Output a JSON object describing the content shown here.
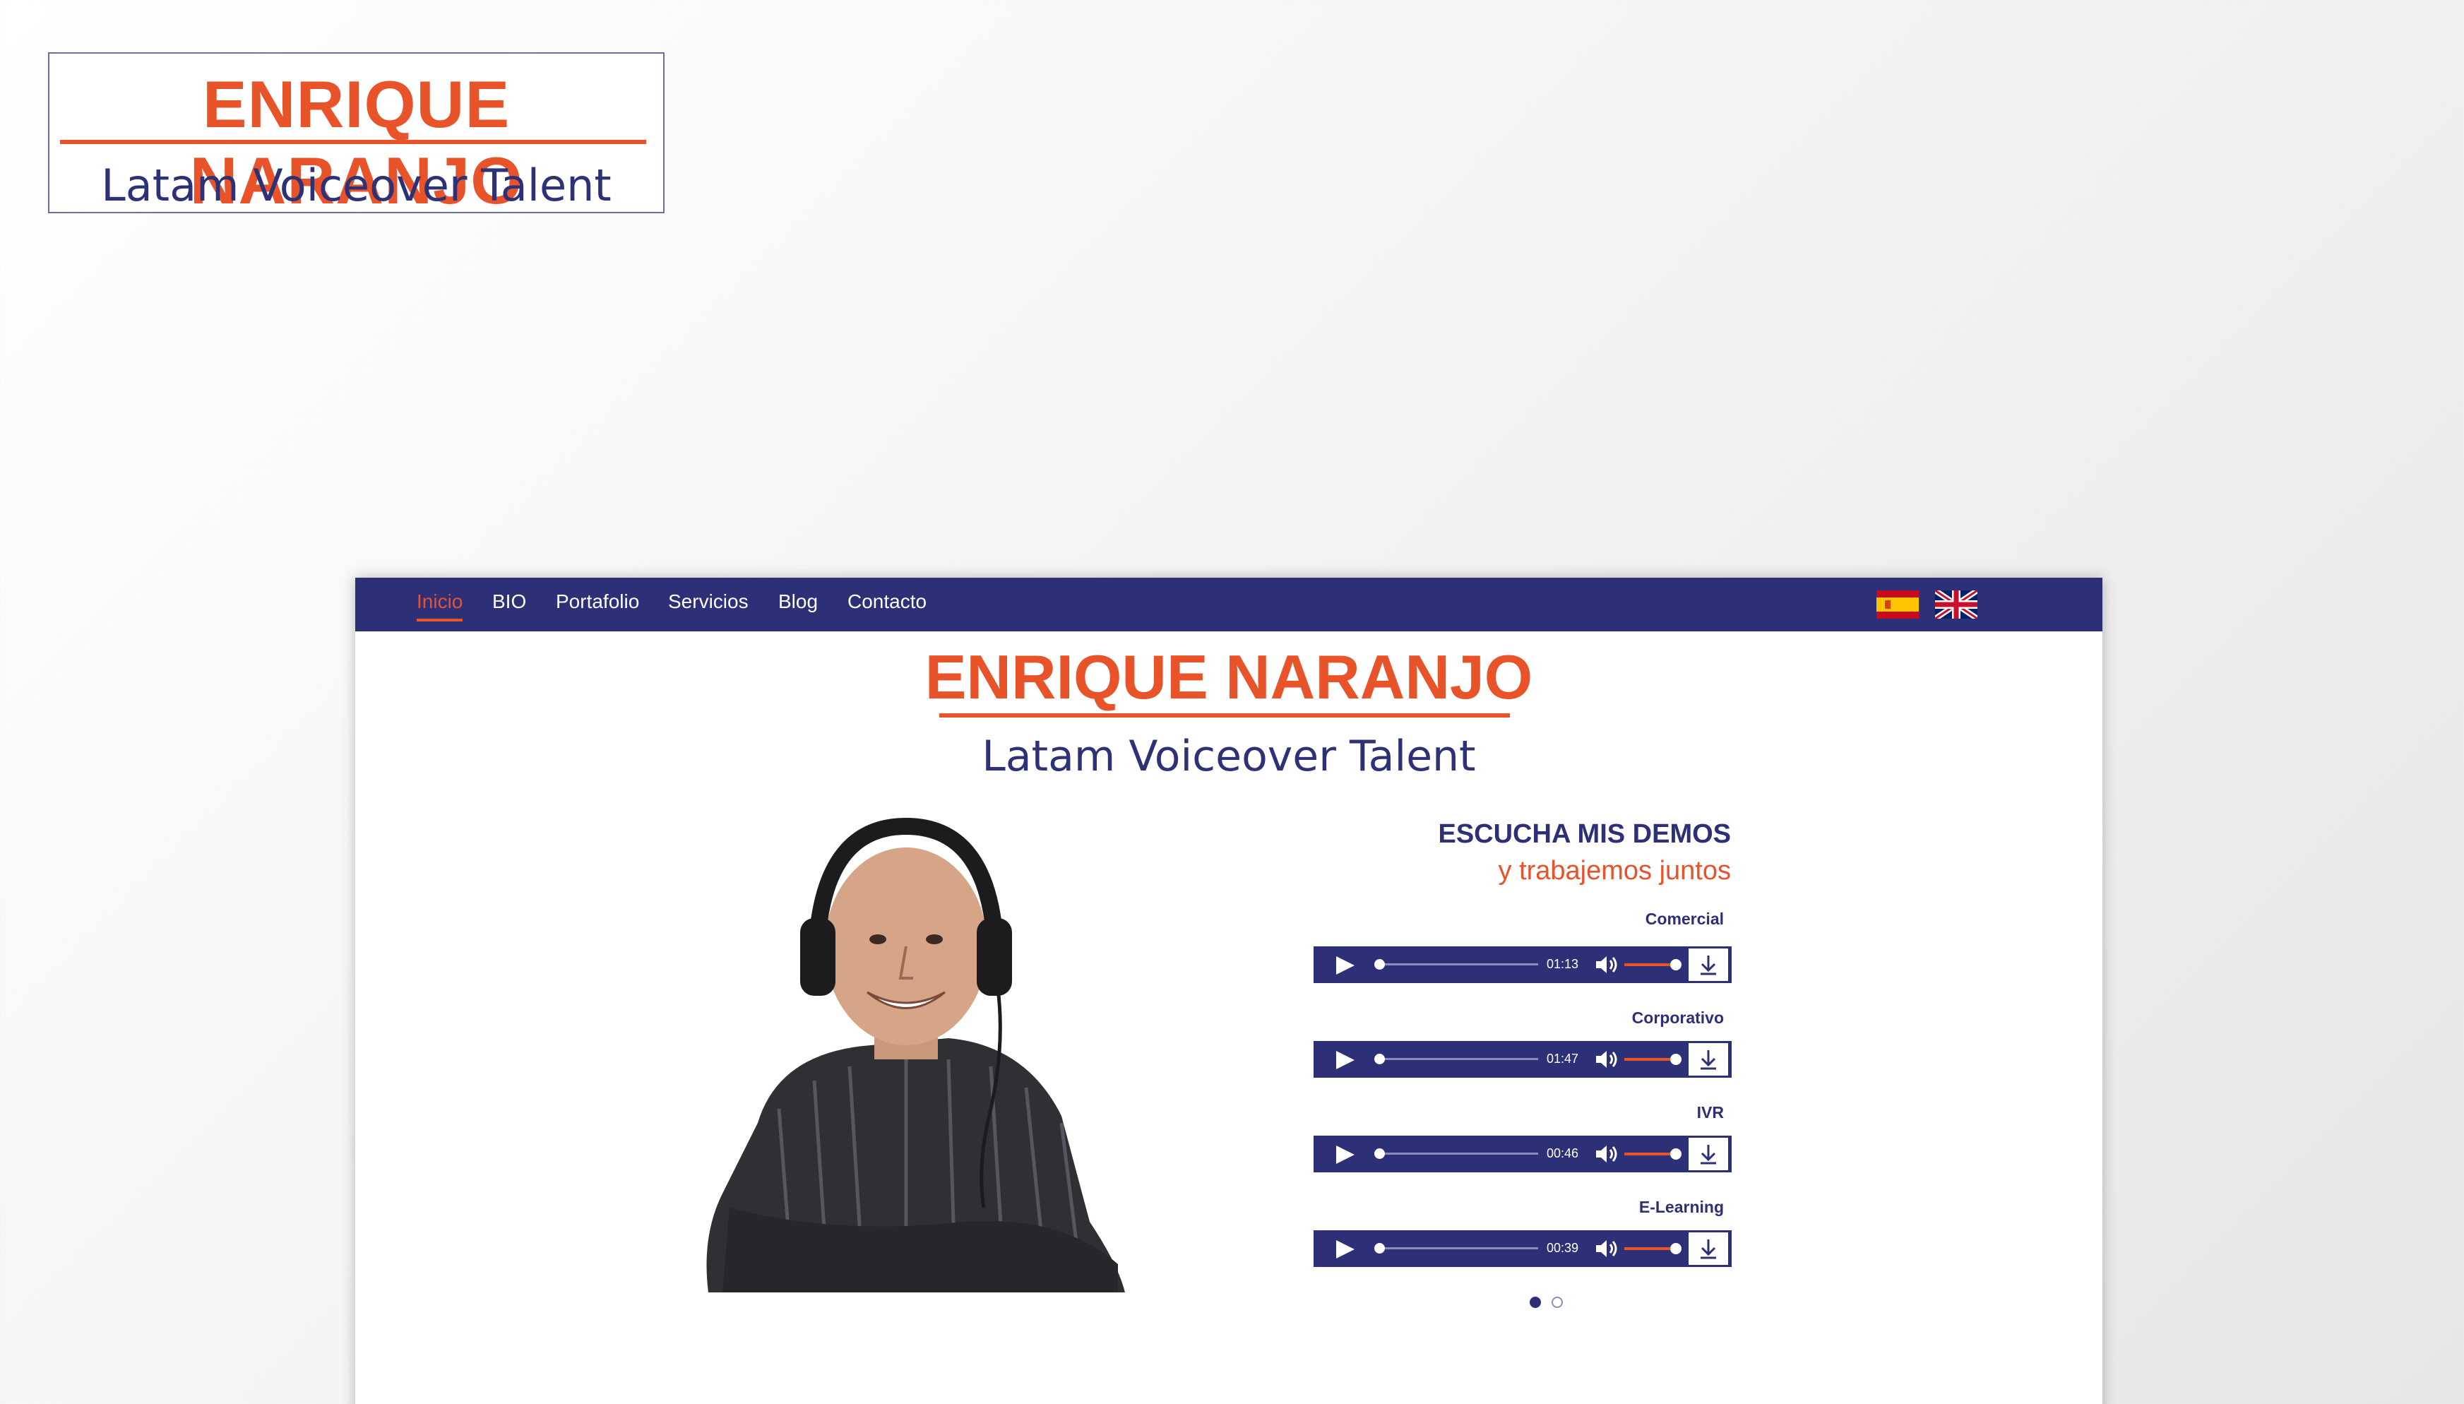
{
  "logo": {
    "name": "ENRIQUE NARANJO",
    "tagline": "Latam Voiceover Talent"
  },
  "nav": {
    "items": [
      {
        "label": "Inicio",
        "active": true
      },
      {
        "label": "BIO"
      },
      {
        "label": "Portafolio"
      },
      {
        "label": "Servicios"
      },
      {
        "label": "Blog"
      },
      {
        "label": "Contacto"
      }
    ],
    "languages": [
      "spanish-flag-icon",
      "uk-flag-icon"
    ]
  },
  "hero": {
    "name": "ENRIQUE NARANJO",
    "tagline": "Latam Voiceover Talent"
  },
  "demos": {
    "title": "ESCUCHA MIS DEMOS",
    "subtitle": "y trabajemos juntos",
    "tracks": [
      {
        "label": "Comercial",
        "duration": "01:13"
      },
      {
        "label": "Corporativo",
        "duration": "01:47"
      },
      {
        "label": "IVR",
        "duration": "00:46"
      },
      {
        "label": "E-Learning",
        "duration": "00:39"
      }
    ],
    "pages": 2,
    "current_page": 1
  },
  "colors": {
    "brand_orange": "#e8532a",
    "brand_navy": "#2d2f77"
  }
}
